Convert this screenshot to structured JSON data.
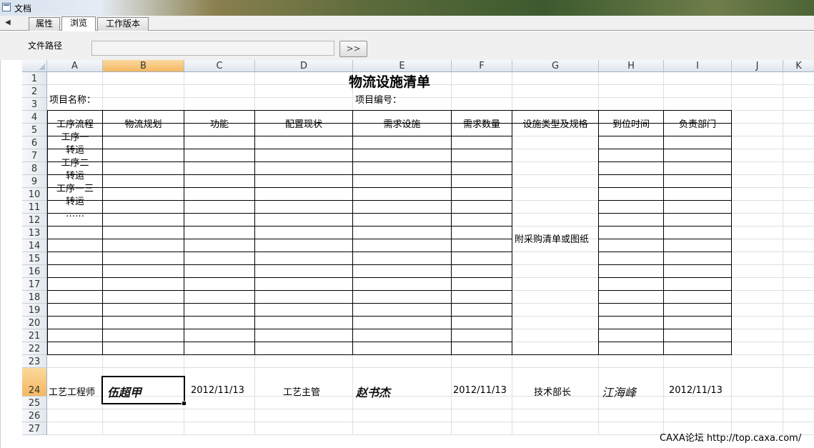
{
  "window": {
    "title": "文档"
  },
  "tabs": [
    {
      "label": "属性"
    },
    {
      "label": "浏览"
    },
    {
      "label": "工作版本"
    }
  ],
  "path_row": {
    "label": "文件路径",
    "path_value": "",
    "browse_button": ">>"
  },
  "columns": [
    "A",
    "B",
    "C",
    "D",
    "E",
    "F",
    "G",
    "H",
    "I",
    "J",
    "K"
  ],
  "rows": [
    "1",
    "2",
    "3",
    "4",
    "5",
    "6",
    "7",
    "8",
    "9",
    "10",
    "11",
    "12",
    "13",
    "14",
    "15",
    "16",
    "17",
    "18",
    "19",
    "20",
    "21",
    "22",
    "23",
    "24",
    "25",
    "26",
    "27"
  ],
  "sheet": {
    "title": "物流设施清单",
    "project_name_label": "项目名称：",
    "project_no_label": "项目编号：",
    "table_headers": [
      "工序流程",
      "物流规划",
      "功能",
      "配置现状",
      "需求设施",
      "需求数量",
      "设施类型及规格",
      "到位时间",
      "负责部门"
    ],
    "process_steps": [
      "工序一",
      "转运",
      "工序二",
      "转运",
      "工序一三",
      "转运",
      "……"
    ],
    "merged_note": "附采购清单或图纸",
    "sign_row": {
      "process_engineer_label": "工艺工程师",
      "process_engineer_signature": "伍超甲",
      "date1": "2012/11/13",
      "process_manager_label": "工艺主管",
      "process_manager_signature": "赵书杰",
      "date2": "2012/11/13",
      "tech_head_label": "技术部长",
      "tech_head_signature": "江海峰",
      "date3": "2012/11/13"
    }
  },
  "footer": {
    "text": "CAXA论坛 http://top.caxa.com/"
  },
  "colors": {
    "selected_header": "#f4b863",
    "grid": "#dadfe5",
    "header_bg": "#dfe5ec"
  }
}
